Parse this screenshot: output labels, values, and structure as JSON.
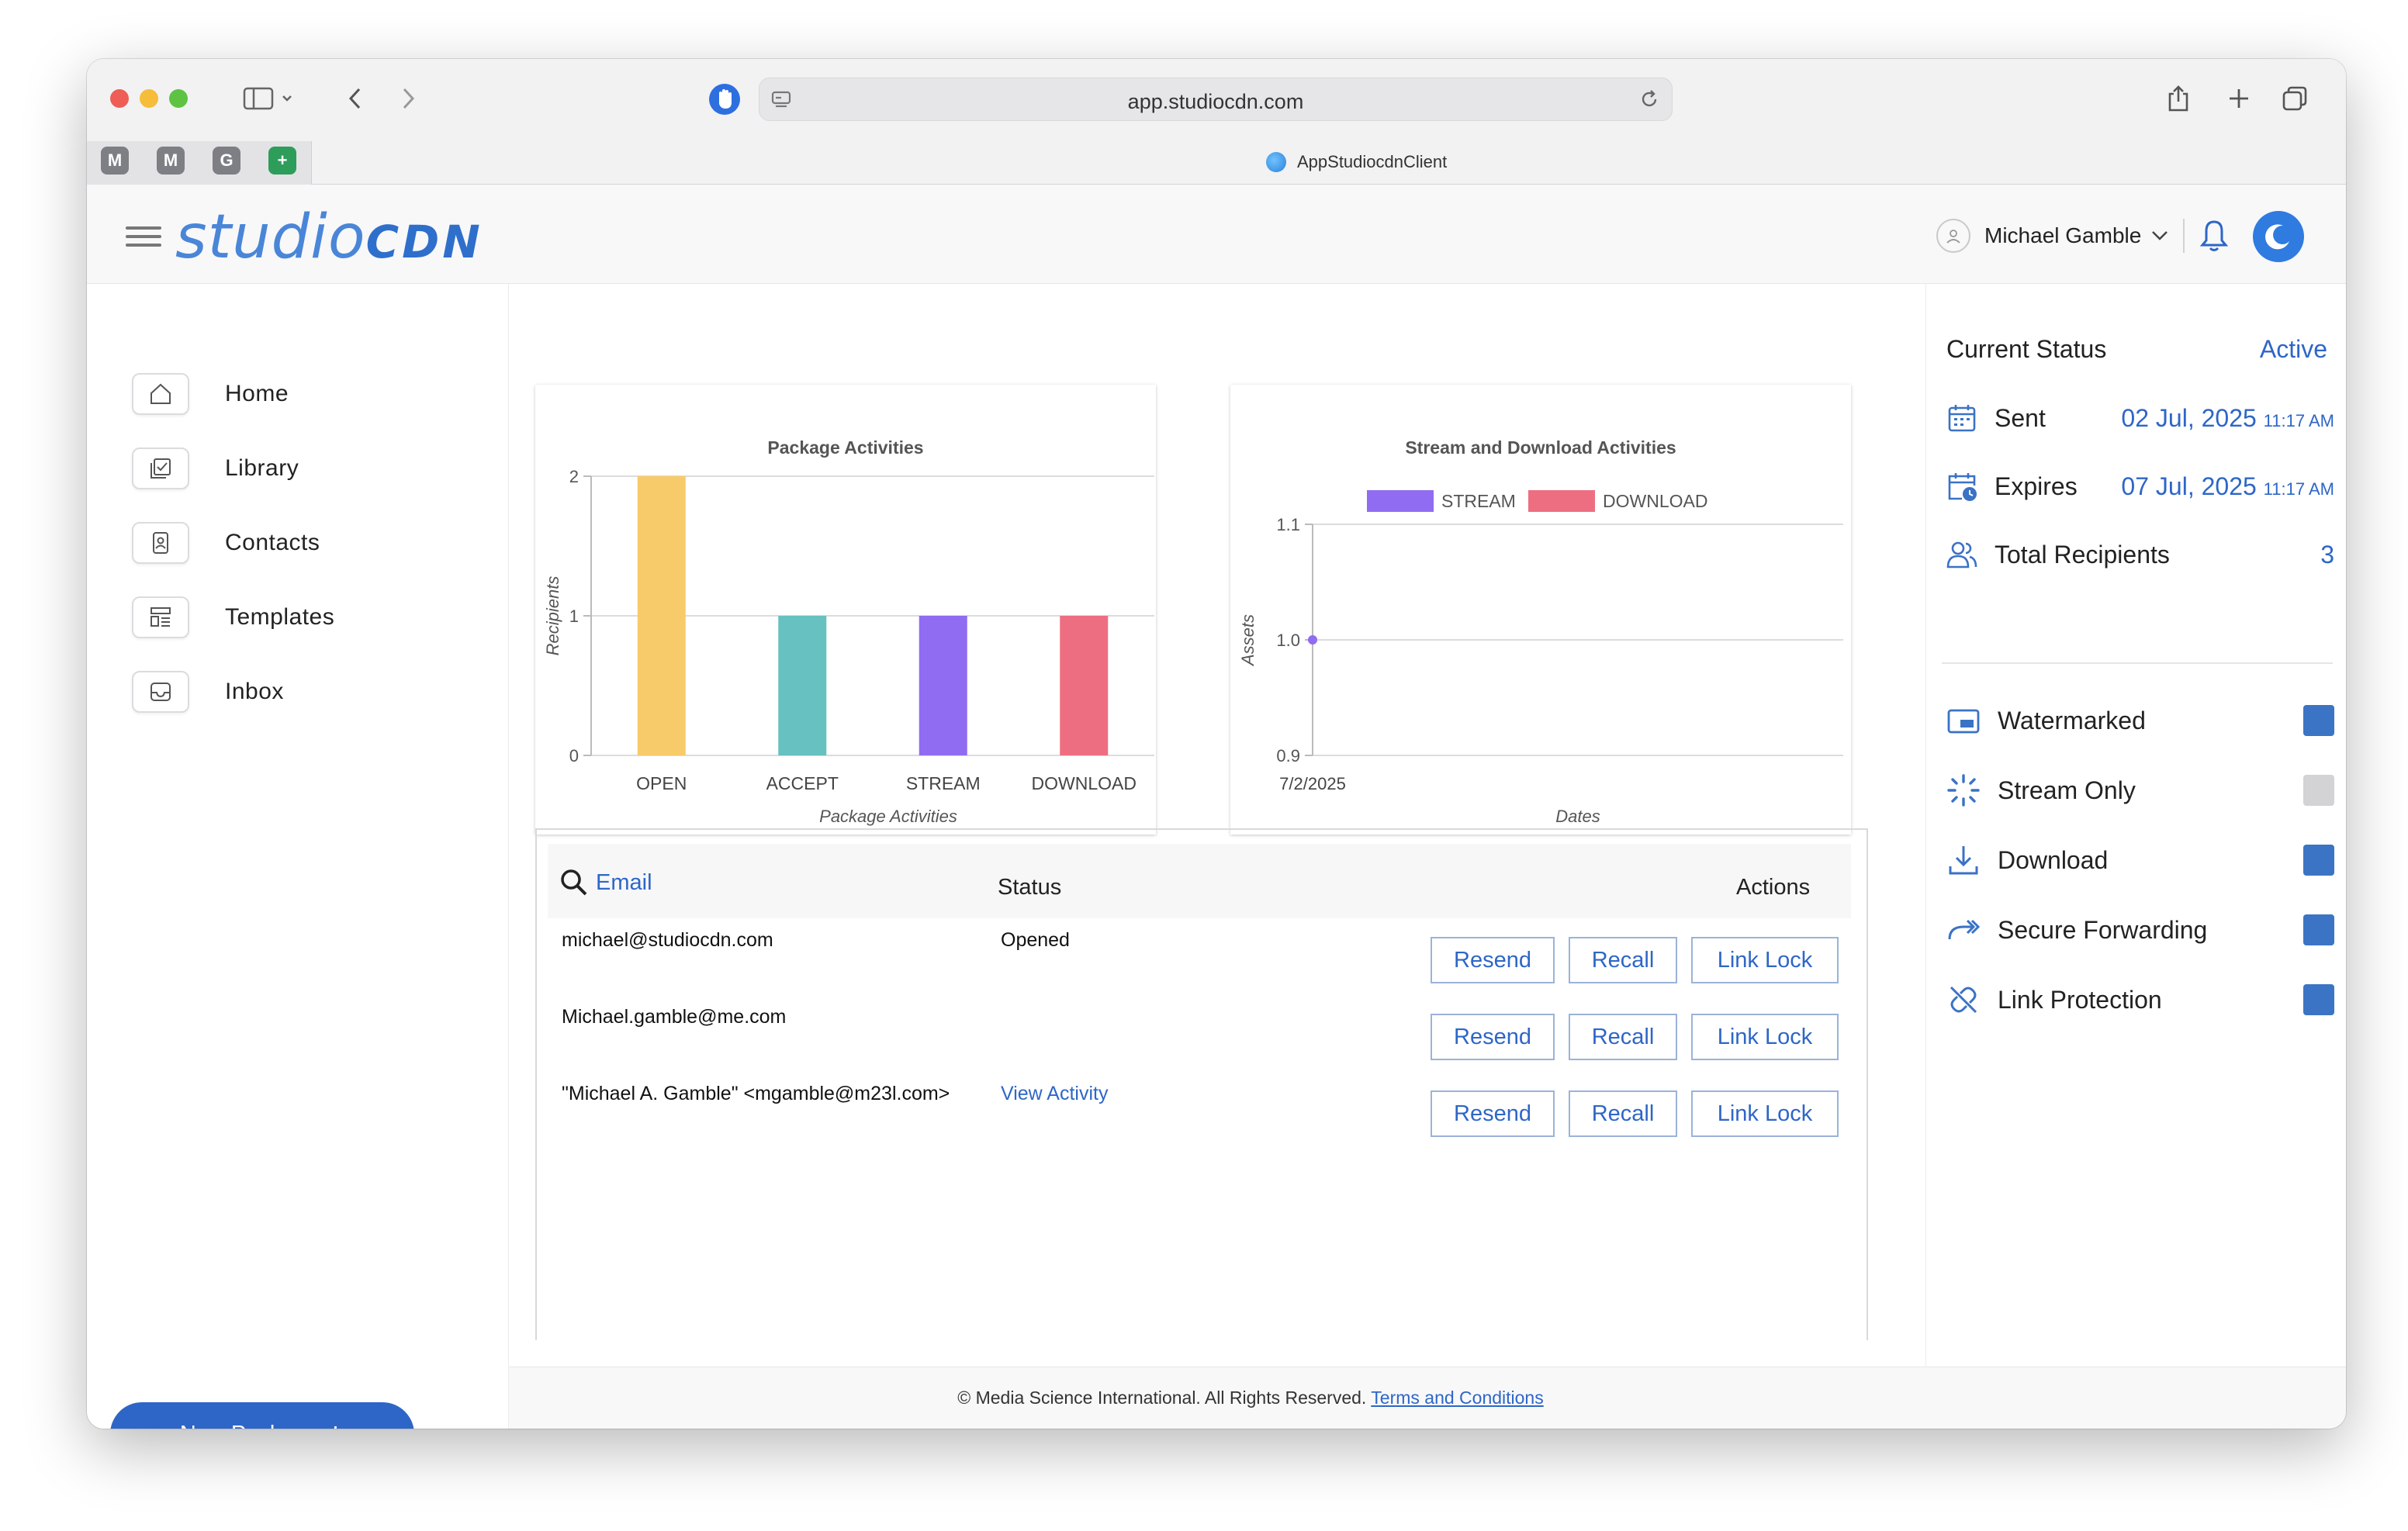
{
  "browser": {
    "url": "app.studiocdn.com",
    "tab_title": "AppStudiocdnClient",
    "pinned_tabs": [
      {
        "label": "M",
        "color": "#7d7f85"
      },
      {
        "label": "M",
        "color": "#7d7f85"
      },
      {
        "label": "G",
        "color": "#7d7f85"
      },
      {
        "label": "+",
        "color": "#2e9d5a"
      }
    ]
  },
  "header": {
    "logo_light": "studio",
    "logo_bold": "CDN",
    "user_name": "Michael Gamble"
  },
  "sidebar": {
    "items": [
      {
        "label": "Home",
        "icon": "home-icon"
      },
      {
        "label": "Library",
        "icon": "library-icon"
      },
      {
        "label": "Contacts",
        "icon": "contacts-icon"
      },
      {
        "label": "Templates",
        "icon": "templates-icon"
      },
      {
        "label": "Inbox",
        "icon": "inbox-icon"
      }
    ],
    "new_package_label": "New Package"
  },
  "chart_data": [
    {
      "type": "bar",
      "title": "Package Activities",
      "xlabel": "Package Activities",
      "ylabel": "Recipients",
      "categories": [
        "OPEN",
        "ACCEPT",
        "STREAM",
        "DOWNLOAD"
      ],
      "values": [
        2,
        1,
        1,
        1
      ],
      "colors": [
        "#f7cb69",
        "#66c1c0",
        "#8f6cf2",
        "#ee6e81"
      ],
      "yticks": [
        "0",
        "1",
        "2"
      ],
      "ylim": [
        0,
        2
      ],
      "grid": true
    },
    {
      "type": "line",
      "title": "Stream and Download Activities",
      "xlabel": "Dates",
      "ylabel": "Assets",
      "x": [
        "7/2/2025"
      ],
      "yticks": [
        "0.9",
        "1.0",
        "1.1"
      ],
      "ylim": [
        0.9,
        1.1
      ],
      "grid": true,
      "legend_position": "top",
      "series": [
        {
          "name": "STREAM",
          "color": "#8f6cf2",
          "values": [
            1.0
          ]
        },
        {
          "name": "DOWNLOAD",
          "color": "#ee6e81",
          "values": []
        }
      ]
    }
  ],
  "table": {
    "header_email": "Email",
    "header_status": "Status",
    "header_actions": "Actions",
    "rows": [
      {
        "email": "michael@studiocdn.com",
        "status": "Opened"
      },
      {
        "email": "Michael.gamble@me.com",
        "status": ""
      },
      {
        "email": "\"Michael A. Gamble\" <mgamble@m23l.com>",
        "status": "View Activity"
      }
    ],
    "actions": {
      "resend": "Resend",
      "recall": "Recall",
      "link_lock": "Link Lock"
    }
  },
  "footer": {
    "text": "© Media Science International. All Rights Reserved.",
    "link": "Terms and Conditions"
  },
  "status_panel": {
    "current_status_label": "Current Status",
    "current_status_value": "Active",
    "sent_label": "Sent",
    "sent_date": "02 Jul, 2025",
    "sent_time": "11:17 AM",
    "expires_label": "Expires",
    "expires_date": "07 Jul, 2025",
    "expires_time": "11:17 AM",
    "total_recipients_label": "Total Recipients",
    "total_recipients_value": "3",
    "options": [
      {
        "label": "Watermarked",
        "checked": true
      },
      {
        "label": "Stream Only",
        "checked": false
      },
      {
        "label": "Download",
        "checked": true
      },
      {
        "label": "Secure Forwarding",
        "checked": true
      },
      {
        "label": "Link Protection",
        "checked": true
      }
    ],
    "colors": {
      "accent": "#2e66c7",
      "checked": "#3b74c4",
      "unchecked": "#d3d3d5"
    }
  }
}
